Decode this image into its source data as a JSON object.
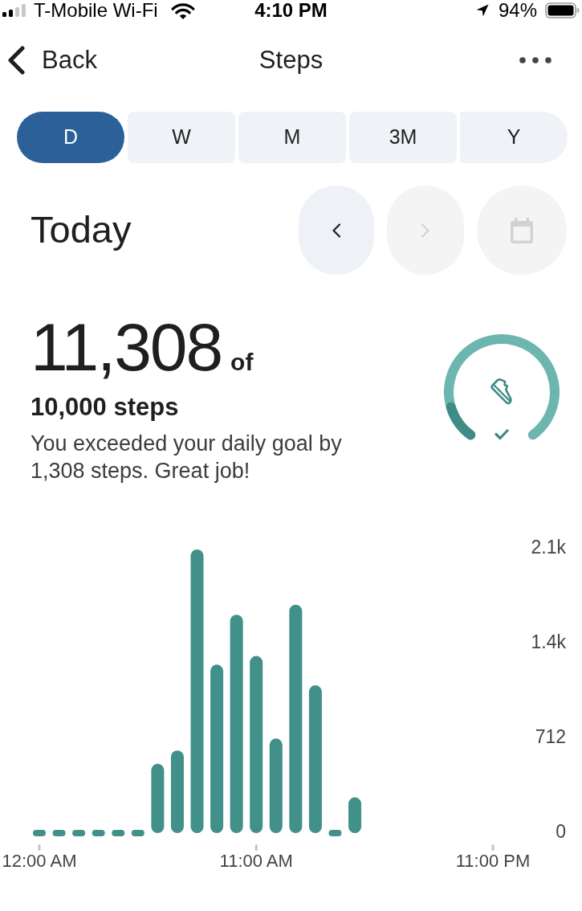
{
  "status_bar": {
    "carrier": "T-Mobile Wi-Fi",
    "time": "4:10 PM",
    "battery": "94%"
  },
  "nav_bar": {
    "back": "Back",
    "title": "Steps"
  },
  "tabs": [
    {
      "label": "D",
      "selected": true
    },
    {
      "label": "W",
      "selected": false
    },
    {
      "label": "M",
      "selected": false
    },
    {
      "label": "3M",
      "selected": false
    },
    {
      "label": "Y",
      "selected": false
    }
  ],
  "period": {
    "title": "Today",
    "buttons": [
      {
        "kind": "previous",
        "disabled": false
      },
      {
        "kind": "next",
        "disabled": true
      },
      {
        "kind": "calendar",
        "disabled": true
      }
    ]
  },
  "summary": {
    "steps": "11,308",
    "of": "of",
    "goal": "10,000 steps",
    "message": "You exceeded your daily goal by 1,308 steps. Great job!",
    "goal_ring": {
      "goal_met": true,
      "extra": {
        "level": 0.13
      }
    }
  },
  "chart": {
    "chart_data": {
      "type": "bar",
      "x": [
        0,
        1,
        2,
        3,
        4,
        5,
        6,
        7,
        8,
        9,
        10,
        11,
        12,
        13,
        14,
        15,
        16
      ],
      "values": [
        0,
        0,
        0,
        0,
        0,
        0,
        520,
        620,
        2130,
        1265,
        1640,
        1330,
        710,
        1715,
        1110,
        0,
        268
      ],
      "xlim": [
        0,
        23
      ],
      "ylim": [
        0,
        2136
      ],
      "xticks": [
        {
          "value": 0,
          "label": "12:00 AM"
        },
        {
          "value": 11,
          "label": "11:00 AM"
        },
        {
          "value": 23,
          "label": "11:00 PM"
        }
      ],
      "yticks": [
        {
          "value": 0,
          "label": "0"
        },
        {
          "value": 712,
          "label": "712"
        },
        {
          "value": 1424,
          "label": "1.4k"
        },
        {
          "value": 2136,
          "label": "2.1k"
        }
      ]
    }
  }
}
